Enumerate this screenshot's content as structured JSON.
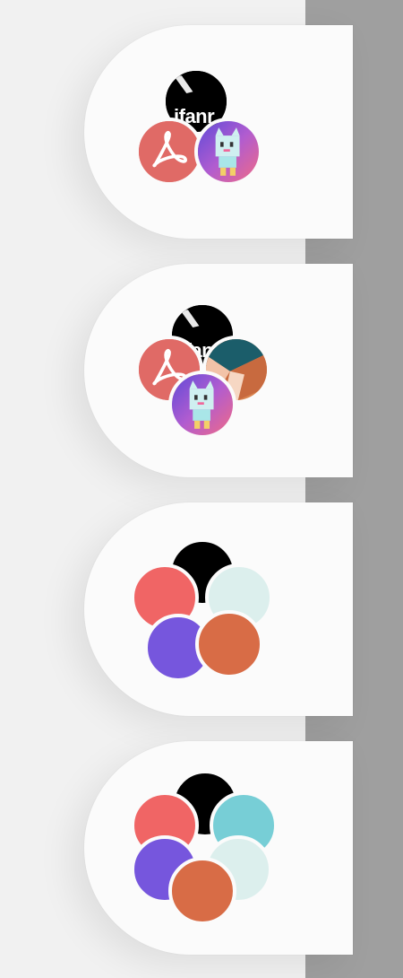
{
  "groups": [
    {
      "apps": [
        {
          "icon": "ifanr-icon",
          "label": "ifanr",
          "color": "#000000"
        },
        {
          "icon": "acrobat-icon",
          "color": "#e06a66"
        },
        {
          "icon": "robot-game-icon",
          "color": "#8a64d6"
        }
      ]
    },
    {
      "apps": [
        {
          "icon": "ifanr-icon",
          "label": "ifanr",
          "color": "#000000"
        },
        {
          "icon": "acrobat-icon",
          "color": "#e06a66"
        },
        {
          "icon": "robot-game-icon",
          "color": "#8a64d6"
        },
        {
          "icon": "copper-shapes-icon",
          "color": "#d9834e"
        }
      ]
    },
    {
      "apps": [
        {
          "icon": "black-circle-icon",
          "color": "#000000"
        },
        {
          "icon": "mint-circle-icon",
          "color": "#dcefed"
        },
        {
          "icon": "red-circle-icon",
          "color": "#f06565"
        },
        {
          "icon": "purple-circle-icon",
          "color": "#7656dd"
        },
        {
          "icon": "orange-circle-icon",
          "color": "#d86c46"
        }
      ]
    },
    {
      "apps": [
        {
          "icon": "black-circle-icon",
          "color": "#000000"
        },
        {
          "icon": "teal-circle-icon",
          "color": "#77ced6"
        },
        {
          "icon": "mint-circle-icon",
          "color": "#dcefed"
        },
        {
          "icon": "red-circle-icon",
          "color": "#f06565"
        },
        {
          "icon": "purple-circle-icon",
          "color": "#7656dd"
        },
        {
          "icon": "orange-circle-icon",
          "color": "#d86c46"
        }
      ]
    }
  ]
}
